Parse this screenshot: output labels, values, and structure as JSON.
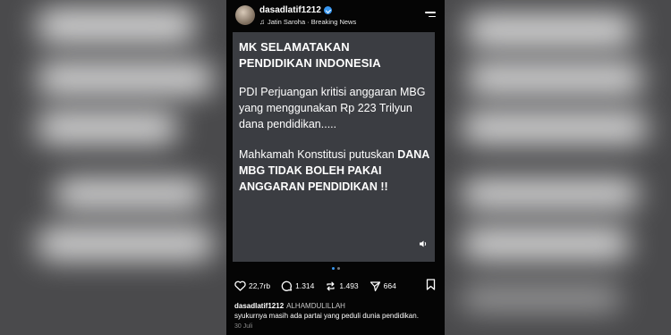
{
  "post": {
    "username": "dasadlatif1212",
    "audio": "Jatin Saroha · Breaking News",
    "headline_line1": "MK SELAMATAKAN",
    "headline_line2": "PENDIDIKAN INDONESIA",
    "paragraph1": "PDI Perjuangan kritisi anggaran MBG yang menggunakan Rp 223 Trilyun dana pendidikan.....",
    "paragraph2_normal": "Mahkamah Konstitusi putuskan ",
    "paragraph2_bold": "DANA MBG TIDAK BOLEH PAKAI ANGGARAN PENDIDIKAN !!"
  },
  "stats": {
    "likes": "22,7rb",
    "comments": "1.314",
    "reposts": "1.493",
    "shares": "664"
  },
  "caption": {
    "username": "dasadlatif1212",
    "line1": "ALHAMDULILLAH",
    "line2": "syukurnya masih ada partai yang peduli dunia pendidikan."
  },
  "date": "30 Juli",
  "colors": {
    "verified": "#3897f0",
    "card_bg": "#3b3d42",
    "background": "#050505"
  }
}
